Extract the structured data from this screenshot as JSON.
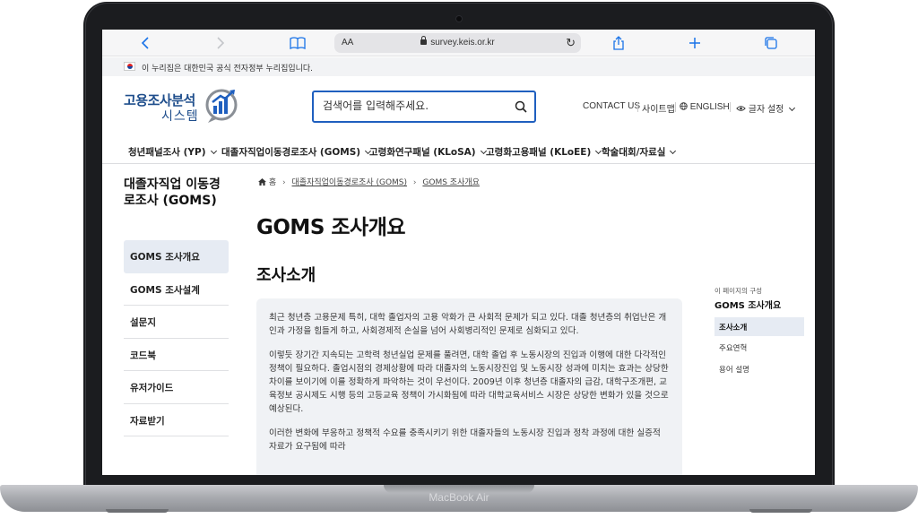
{
  "device": {
    "label": "MacBook Air"
  },
  "browser": {
    "text_size_label": "AA",
    "url": "survey.keis.or.kr"
  },
  "gov_banner": {
    "text": "이 누리집은 대한민국 공식 전자정부 누리집입니다."
  },
  "logo": {
    "line1": "고용조사분석",
    "line2": "시스템"
  },
  "search": {
    "placeholder": "검색어를 입력해주세요."
  },
  "utility": {
    "contact": "CONTACT US",
    "sitemap": "사이트맵",
    "language": "ENGLISH",
    "text_settings": "글자 설정"
  },
  "gnb": {
    "items": [
      {
        "label": "청년패널조사 (YP)"
      },
      {
        "label": "대졸자직업이동경로조사 (GOMS)"
      },
      {
        "label": "고령화연구패널 (KLoSA)"
      },
      {
        "label": "고령화고용패널 (KLoEE)"
      },
      {
        "label": "학술대회/자료실"
      }
    ]
  },
  "side": {
    "title": "대졸자직업 이동경로조사 (GOMS)",
    "items": [
      {
        "label": "GOMS 조사개요",
        "active": true
      },
      {
        "label": "GOMS 조사설계"
      },
      {
        "label": "설문지"
      },
      {
        "label": "코드북"
      },
      {
        "label": "유저가이드"
      },
      {
        "label": "자료받기"
      }
    ]
  },
  "breadcrumb": {
    "home": "홈",
    "level1": "대졸자직업이동경로조사 (GOMS)",
    "level2": "GOMS 조사개요"
  },
  "main": {
    "title": "GOMS 조사개요",
    "section": "조사소개",
    "paragraphs": [
      "최근 청년층 고용문제 특히, 대학 졸업자의 고용 악화가 큰 사회적 문제가 되고 있다. 대졸 청년층의 취업난은 개인과 가정을 힘들게 하고, 사회경제적 손실을 넘어 사회병리적인 문제로 심화되고 있다.",
      "이렇듯 장기간 지속되는 고학력 청년실업 문제를 풀려면, 대학 졸업 후 노동시장의 진입과 이행에 대한 다각적인 정책이 필요하다. 졸업시점의 경제상황에 따라 대졸자의 노동시장진입 및 노동시장 성과에 미치는 효과는 상당한 차이를 보이기에 이를 정확하게 파악하는 것이 우선이다. 2009년 이후 청년층 대졸자의 급감, 대학구조개편, 교육정보 공시제도 시행 등의 고등교육 정책이 가시화됨에 따라 대학교육서비스 시장은 상당한 변화가 있을 것으로 예상된다.",
      "이러한 변화에 부응하고 정책적 수요를 충족시키기 위한 대졸자들의 노동시장 진입과 정착 과정에 대한 실증적 자료가 요구됨에 따라"
    ]
  },
  "toc": {
    "caption": "이 페이지의 구성",
    "title": "GOMS 조사개요",
    "items": [
      {
        "label": "조사소개",
        "active": true
      },
      {
        "label": "주요연혁"
      },
      {
        "label": "용어 설명"
      }
    ]
  }
}
